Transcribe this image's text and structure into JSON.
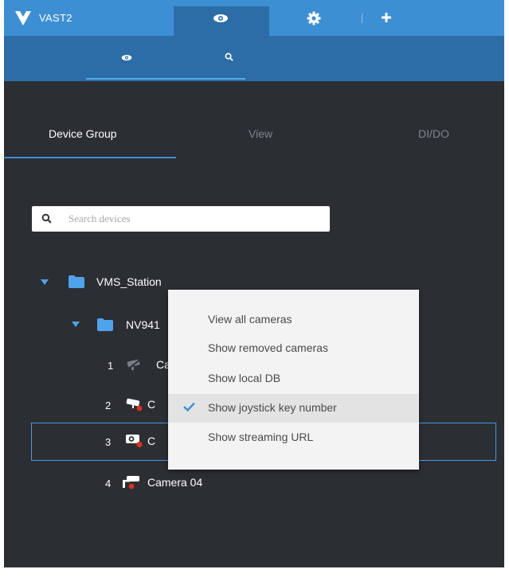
{
  "app": {
    "title": "VAST2"
  },
  "top_tabs": [
    {
      "icon": "eye-icon",
      "active": true
    },
    {
      "icon": "gear-icon",
      "active": false
    },
    {
      "icon": "plus-icon",
      "active": false
    }
  ],
  "sub_tabs": [
    {
      "icon": "eye-icon",
      "active": true
    },
    {
      "icon": "search-icon",
      "active": false
    }
  ],
  "device_tabs": [
    {
      "label": "Device Group",
      "active": true
    },
    {
      "label": "View",
      "active": false
    },
    {
      "label": "DI/DO",
      "active": false
    }
  ],
  "search": {
    "placeholder": "Search devices",
    "value": ""
  },
  "tree": {
    "station": {
      "label": "VMS_Station",
      "expanded": true
    },
    "nvr": {
      "label": "NV941",
      "expanded": true
    },
    "cameras": [
      {
        "number": "1",
        "label": "Ca",
        "icon": "camera-disconnected-icon"
      },
      {
        "number": "2",
        "label": "C",
        "icon": "bullet-camera-icon"
      },
      {
        "number": "3",
        "label": "C",
        "icon": "box-camera-icon",
        "selected": true
      },
      {
        "number": "4",
        "label": "Camera 04",
        "icon": "bullet-camera-icon"
      }
    ]
  },
  "context_menu": {
    "items": [
      {
        "label": "View all cameras",
        "checked": false
      },
      {
        "label": "Show removed cameras",
        "checked": false
      },
      {
        "label": "Show local DB",
        "checked": false
      },
      {
        "label": "Show joystick key number",
        "checked": true
      },
      {
        "label": "Show streaming URL",
        "checked": false
      }
    ]
  },
  "colors": {
    "accent": "#3d8fd4",
    "accent_dark": "#2d6da7",
    "panel_bg": "#2b2e33",
    "menu_bg": "#f3f3f3",
    "alert_red": "#e0301e"
  }
}
